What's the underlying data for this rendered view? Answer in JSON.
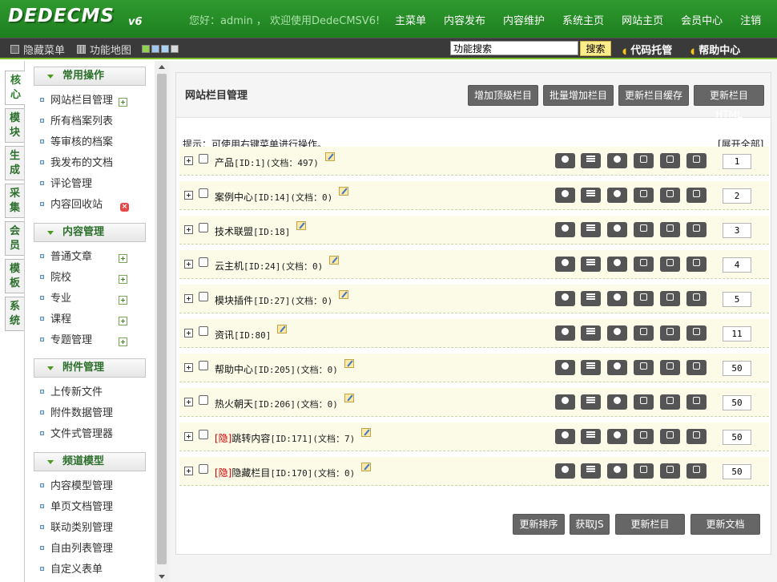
{
  "header": {
    "logo": "DEDECMS",
    "version": "v6",
    "welcome": "您好：admin ， 欢迎使用DedeCMSV6!",
    "nav": [
      "主菜单",
      "内容发布",
      "内容维护",
      "系统主页",
      "网站主页",
      "会员中心",
      "注销"
    ]
  },
  "toolbar": {
    "hide_menu": "隐藏菜单",
    "sitemap": "功能地图",
    "swatch_colors": [
      "#8fd14f",
      "#9fc7ef",
      "#a9d3f5",
      "#d9d9d9"
    ],
    "search_value": "功能搜索",
    "search_button": "搜索",
    "code_hosting": "代码托管",
    "help_center": "帮助中心"
  },
  "vtabs": [
    {
      "label": "核心",
      "active": true
    },
    {
      "label": "模块"
    },
    {
      "label": "生成"
    },
    {
      "label": "采集"
    },
    {
      "label": "会员"
    },
    {
      "label": "模板"
    },
    {
      "label": "系统"
    }
  ],
  "menu": {
    "groups": [
      {
        "title": "常用操作",
        "items": [
          {
            "label": "网站栏目管理",
            "icon": "add"
          },
          {
            "label": "所有档案列表"
          },
          {
            "label": "等审核的档案"
          },
          {
            "label": "我发布的文档"
          },
          {
            "label": "评论管理"
          },
          {
            "label": "内容回收站",
            "icon": "delete"
          }
        ]
      },
      {
        "title": "内容管理",
        "items": [
          {
            "label": "普通文章",
            "icon": "add"
          },
          {
            "label": "院校",
            "icon": "add"
          },
          {
            "label": "专业",
            "icon": "add"
          },
          {
            "label": "课程",
            "icon": "add"
          },
          {
            "label": "专题管理",
            "icon": "add"
          }
        ]
      },
      {
        "title": "附件管理",
        "items": [
          {
            "label": "上传新文件"
          },
          {
            "label": "附件数据管理"
          },
          {
            "label": "文件式管理器"
          }
        ]
      },
      {
        "title": "频道模型",
        "items": [
          {
            "label": "内容模型管理"
          },
          {
            "label": "单页文档管理"
          },
          {
            "label": "联动类别管理"
          },
          {
            "label": "自由列表管理"
          },
          {
            "label": "自定义表单"
          }
        ]
      }
    ]
  },
  "main": {
    "title": "网站栏目管理",
    "top_buttons": [
      "增加顶级栏目",
      "批量增加栏目",
      "更新栏目缓存",
      "更新栏目HTML"
    ],
    "tip": "提示：可使用右键菜单进行操作。",
    "expand_all": "[展开全部]",
    "rows": [
      {
        "hidden_tag": "",
        "name": "产品",
        "meta": "[ID:1](文档：497)",
        "order": "1"
      },
      {
        "hidden_tag": "",
        "name": "案例中心",
        "meta": "[ID:14](文档：0)",
        "order": "2"
      },
      {
        "hidden_tag": "",
        "name": "技术联盟",
        "meta": "[ID:18]",
        "order": "3"
      },
      {
        "hidden_tag": "",
        "name": "云主机",
        "meta": "[ID:24](文档：0)",
        "order": "4"
      },
      {
        "hidden_tag": "",
        "name": "模块插件",
        "meta": "[ID:27](文档：0)",
        "order": "5"
      },
      {
        "hidden_tag": "",
        "name": "资讯",
        "meta": "[ID:80]",
        "order": "11"
      },
      {
        "hidden_tag": "",
        "name": "帮助中心",
        "meta": "[ID:205](文档：0)",
        "order": "50"
      },
      {
        "hidden_tag": "",
        "name": "热火朝天",
        "meta": "[ID:206](文档：0)",
        "order": "50"
      },
      {
        "hidden_tag": "[隐]",
        "name": "跳转内容",
        "meta": "[ID:171](文档：7)",
        "order": "50"
      },
      {
        "hidden_tag": "[隐]",
        "name": "隐藏栏目",
        "meta": "[ID:170](文档：0)",
        "order": "50"
      }
    ],
    "row_actions": [
      "preview-icon",
      "list-icon",
      "add-child-icon",
      "edit-icon",
      "move-icon",
      "delete-icon"
    ],
    "bottom_buttons": [
      "更新排序",
      "获取JS",
      "更新栏目HTML",
      "更新文档HTML"
    ]
  }
}
